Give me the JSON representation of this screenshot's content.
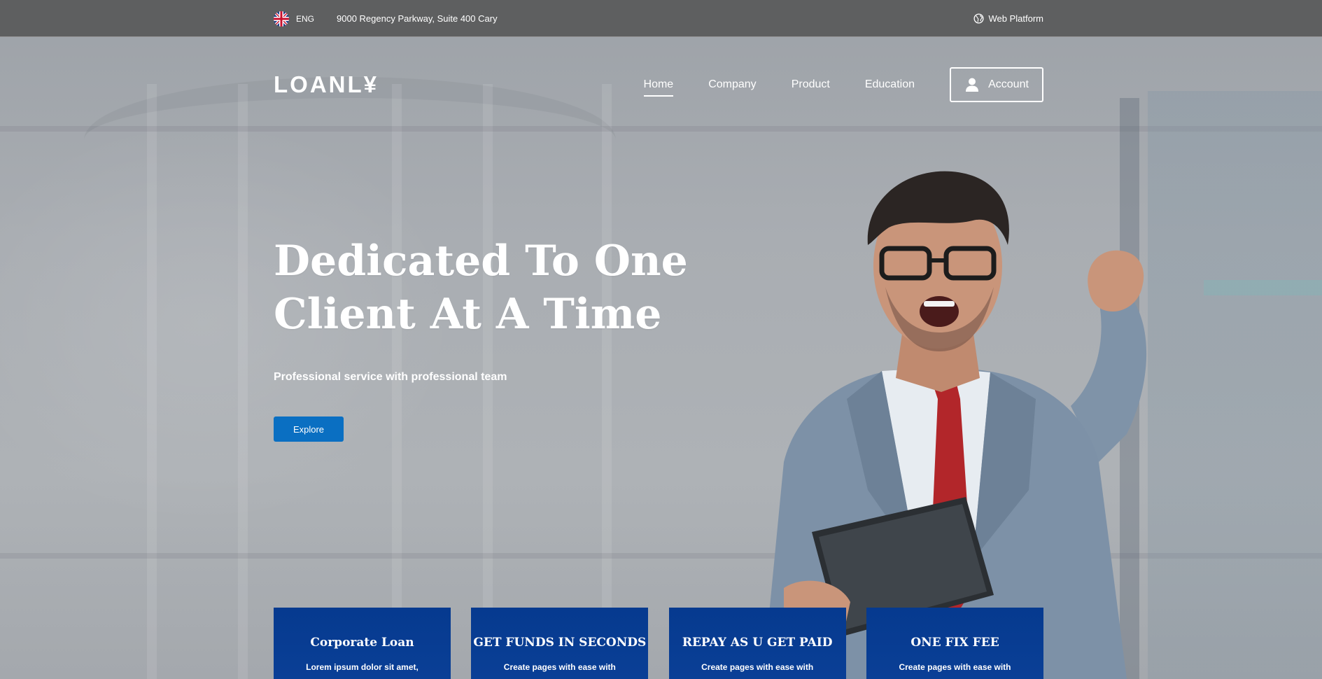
{
  "topbar": {
    "language": "ENG",
    "address": "9000 Regency Parkway, Suite 400 Cary",
    "web_platform": "Web Platform"
  },
  "navbar": {
    "logo": "LOANL¥",
    "links": [
      {
        "label": "Home",
        "active": true
      },
      {
        "label": "Company",
        "active": false
      },
      {
        "label": "Product",
        "active": false
      },
      {
        "label": "Education",
        "active": false
      }
    ],
    "account_label": "Account"
  },
  "hero": {
    "title_line1": "Dedicated To One",
    "title_line2": "Client At A Time",
    "subtitle": "Professional service with professional team",
    "cta_label": "Explore"
  },
  "cards": [
    {
      "title": "Corporate Loan",
      "text": "Lorem ipsum dolor sit amet,"
    },
    {
      "title": "GET FUNDS IN SECONDS",
      "text": "Create pages with ease with"
    },
    {
      "title": "REPAY AS U GET PAID",
      "text": "Create pages with ease with"
    },
    {
      "title": "ONE FIX FEE",
      "text": "Create pages with ease with"
    }
  ],
  "colors": {
    "primary_button": "#0a6fc2",
    "card_background": "#0a3f96",
    "topbar_background": "#555555"
  },
  "icons": {
    "language": "uk-flag-icon",
    "web_platform": "globe-icon",
    "account": "user-icon"
  }
}
